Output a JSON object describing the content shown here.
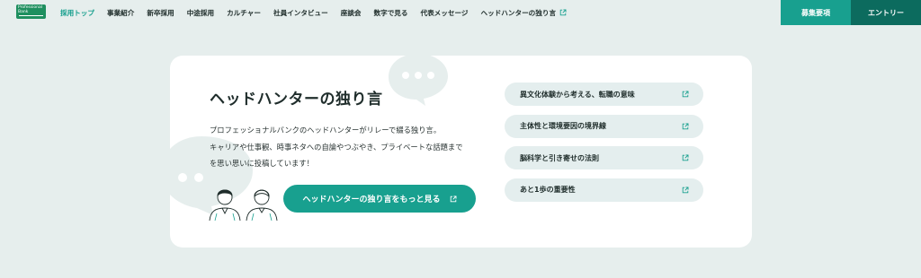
{
  "header": {
    "logo_text": "Professional Bank",
    "nav": [
      {
        "label": "採用トップ",
        "active": true
      },
      {
        "label": "事業紹介"
      },
      {
        "label": "新卒採用"
      },
      {
        "label": "中途採用"
      },
      {
        "label": "カルチャー"
      },
      {
        "label": "社員インタビュー"
      },
      {
        "label": "座談会"
      },
      {
        "label": "数字で見る"
      },
      {
        "label": "代表メッセージ"
      },
      {
        "label": "ヘッドハンターの独り言",
        "external": true
      }
    ],
    "recruit_label": "募集要項",
    "entry_label": "エントリー"
  },
  "card": {
    "title": "ヘッドハンターの独り言",
    "desc_lines": [
      "プロフェッショナルバンクのヘッドハンターがリレーで綴る独り言。",
      "キャリアや仕事観、時事ネタへの自論やつぶやき、プライベートな話題まで",
      "を思い思いに投稿しています！"
    ],
    "more_label": "ヘッドハンターの独り言をもっと見る",
    "links": [
      "異文化体験から考える、転職の意味",
      "主体性と環境要因の境界線",
      "脳科学と引き寄せの法則",
      "あと1歩の重要性"
    ]
  },
  "colors": {
    "accent": "#18a08f",
    "accent_dark": "#0c6b5e",
    "background": "#e6eeed",
    "pill": "#e4eeee"
  }
}
